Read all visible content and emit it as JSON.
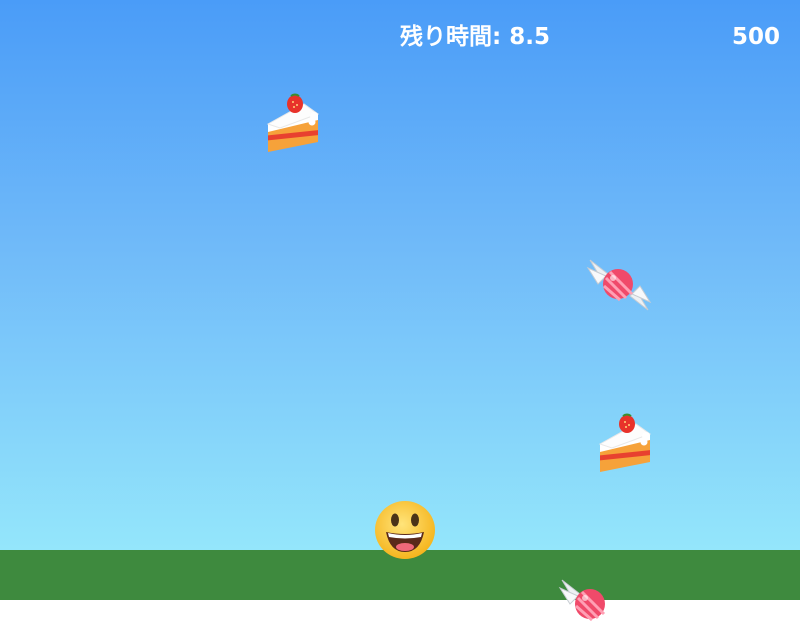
{
  "hud": {
    "timer_label": "残り時間: 8.5",
    "score": "500"
  },
  "icons": {
    "player": "smiling-face-icon",
    "cake": "shortcake-icon",
    "candy": "candy-icon"
  },
  "colors": {
    "sky_top": "#4a9cf8",
    "sky_bottom": "#94e6fb",
    "ground": "#3e8a3e",
    "hud_text": "#ffffff"
  }
}
